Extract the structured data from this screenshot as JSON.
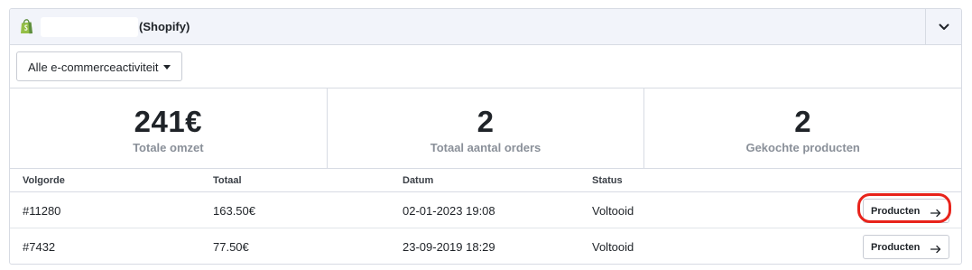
{
  "header": {
    "store_platform": "(Shopify)",
    "logo_icon": "shopify-bag-icon",
    "collapse_icon": "chevron-down-icon"
  },
  "filter": {
    "selected": "Alle e-commerceactiviteit",
    "icon": "caret-down-icon"
  },
  "stats": [
    {
      "value": "241€",
      "label": "Totale omzet"
    },
    {
      "value": "2",
      "label": "Totaal aantal orders"
    },
    {
      "value": "2",
      "label": "Gekochte producten"
    }
  ],
  "table": {
    "columns": [
      "Volgorde",
      "Totaal",
      "Datum",
      "Status"
    ],
    "rows": [
      {
        "order": "#11280",
        "total": "163.50€",
        "date": "02-01-2023 19:08",
        "status": "Voltooid",
        "button": "Producten",
        "highlighted": true
      },
      {
        "order": "#7432",
        "total": "77.50€",
        "date": "23-09-2019 18:29",
        "status": "Voltooid",
        "button": "Producten",
        "highlighted": false
      }
    ]
  },
  "colors": {
    "header_bg": "#f2f4fa",
    "border": "#d7dbe3",
    "highlight": "#e8231b",
    "shopify_green": "#95bf47"
  }
}
